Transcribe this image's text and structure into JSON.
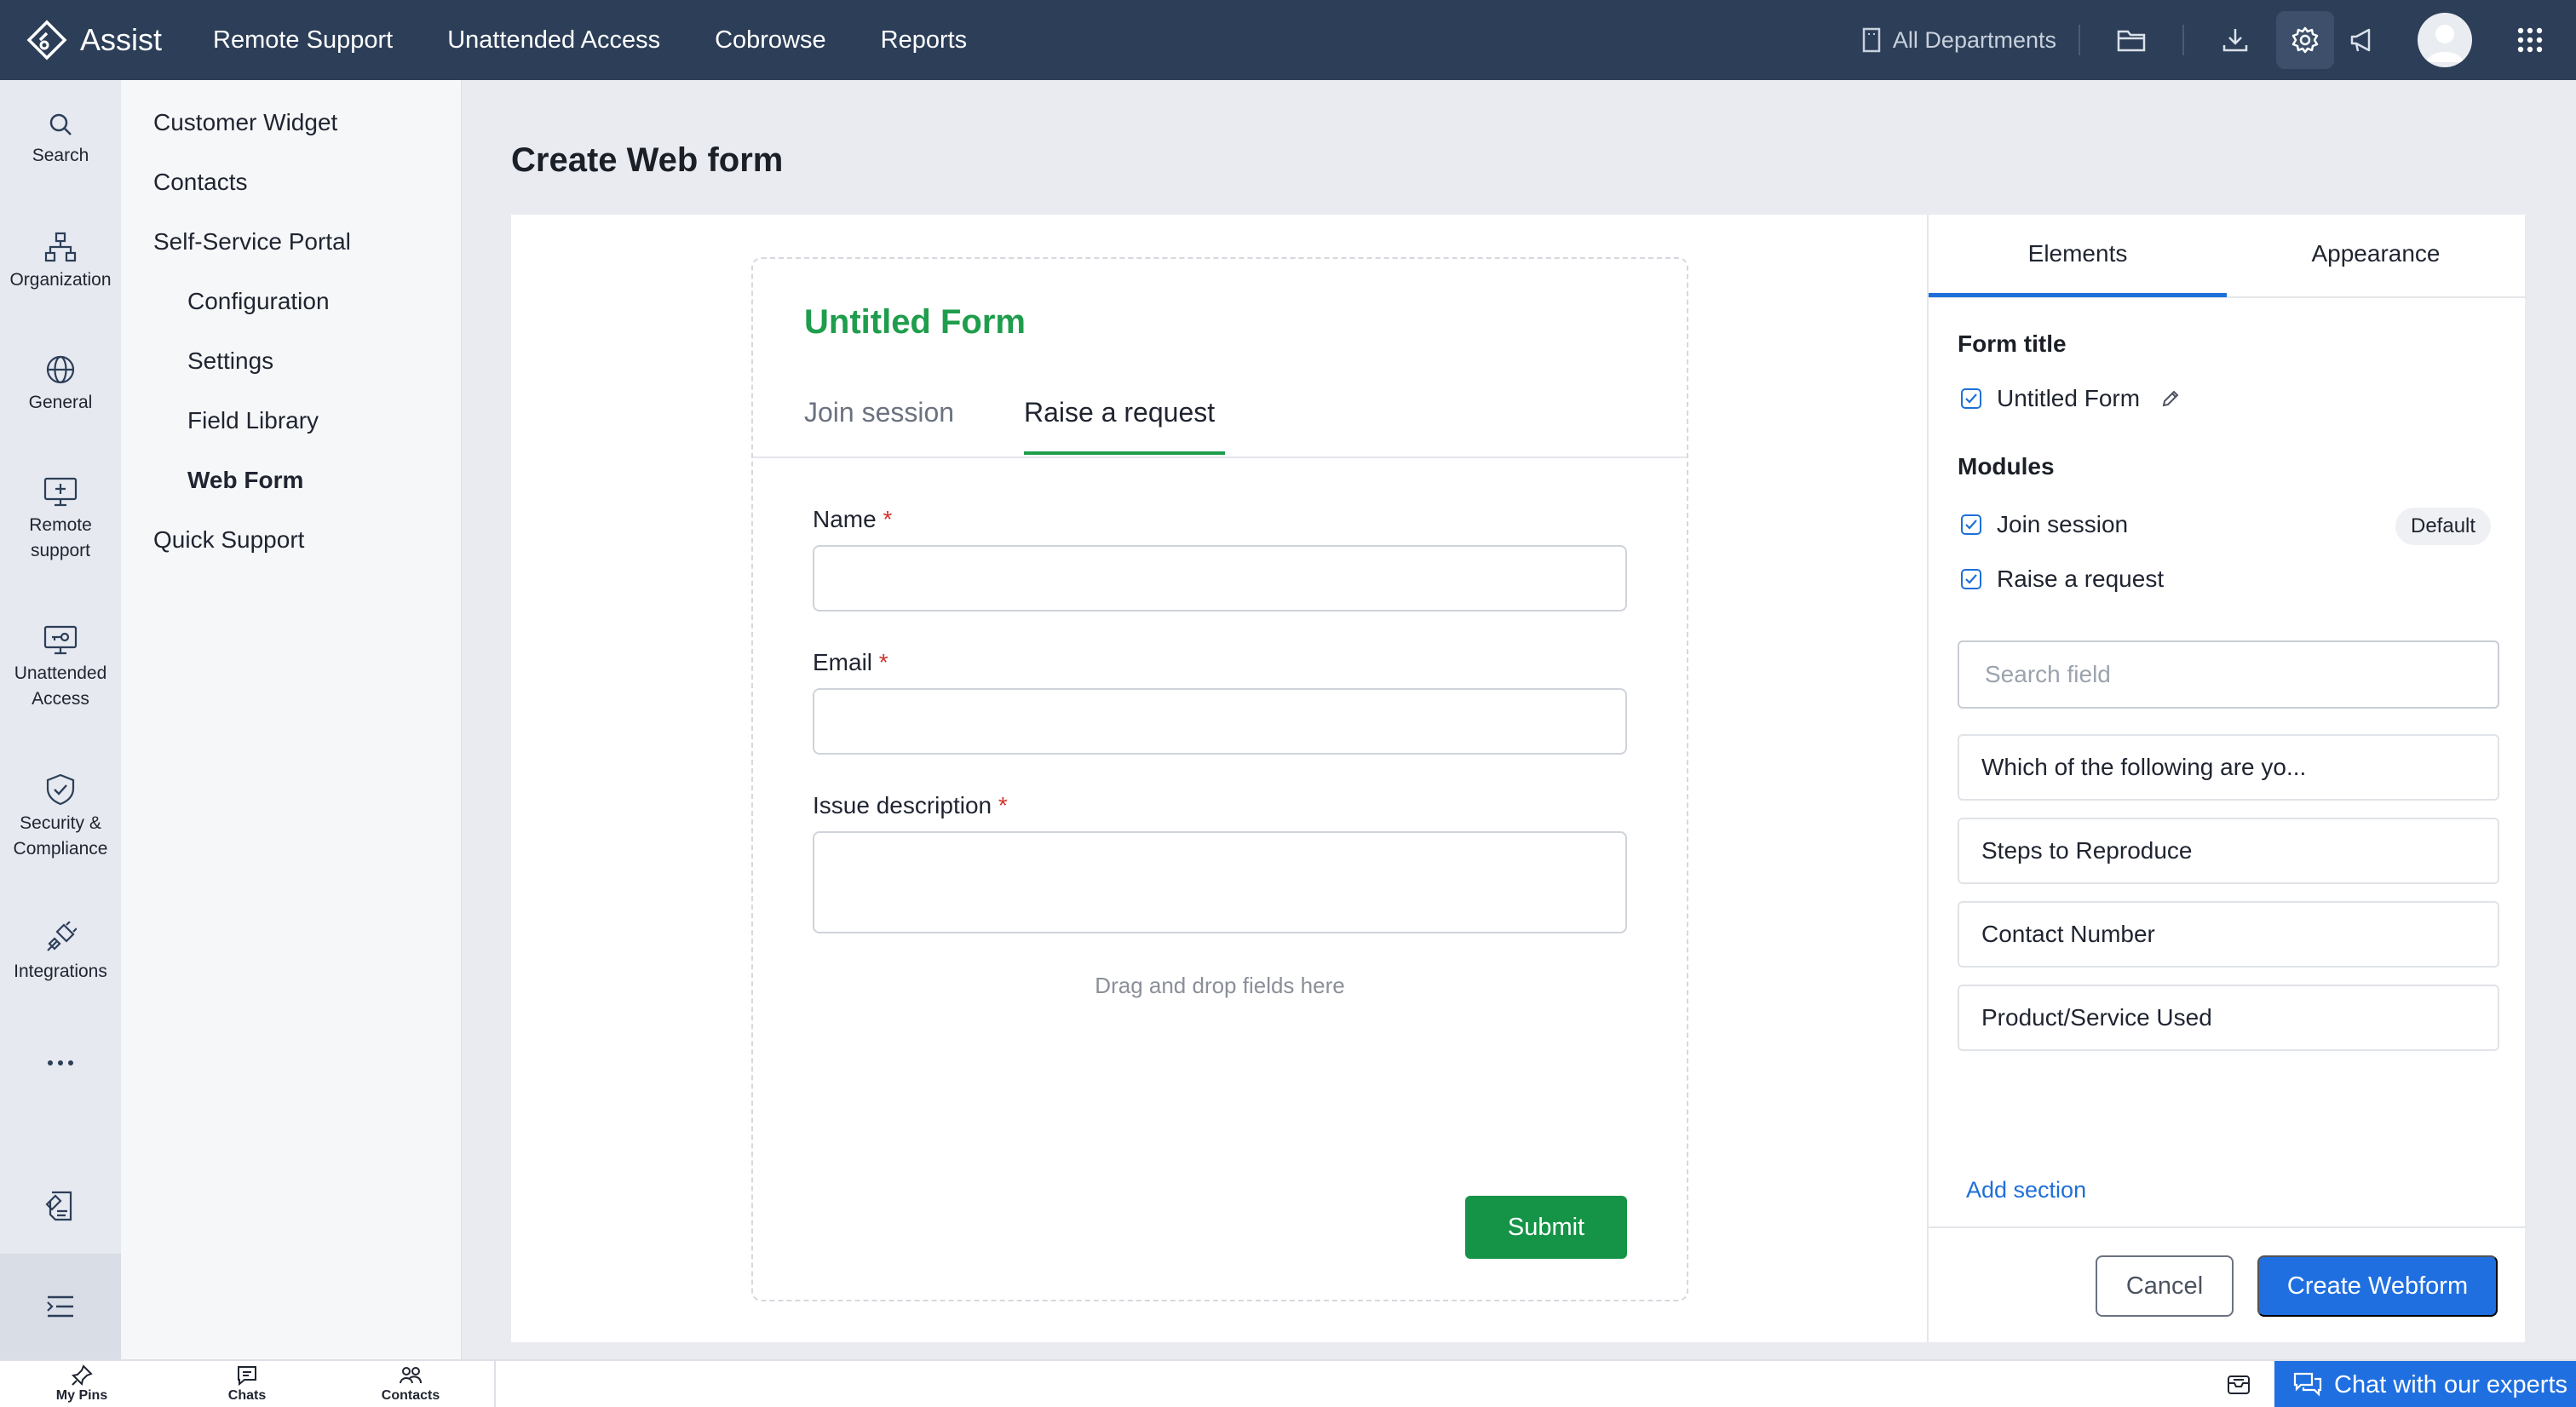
{
  "app": {
    "name": "Assist"
  },
  "topnav": {
    "items": [
      "Remote Support",
      "Unattended Access",
      "Cobrowse",
      "Reports"
    ]
  },
  "topright": {
    "department": "All Departments"
  },
  "leftrail": {
    "items": [
      {
        "label": "Search",
        "icon": "search-icon"
      },
      {
        "label": "Organization",
        "icon": "organization-icon"
      },
      {
        "label": "General",
        "icon": "globe-icon"
      },
      {
        "label": "Remote support",
        "icon": "monitor-plus-icon"
      },
      {
        "label": "Unattended Access",
        "icon": "monitor-key-icon"
      },
      {
        "label": "Security & Compliance",
        "icon": "shield-check-icon"
      },
      {
        "label": "Integrations",
        "icon": "plug-icon"
      }
    ]
  },
  "subnav": {
    "customer_widget": "Customer Widget",
    "contacts": "Contacts",
    "self_service": "Self-Service Portal",
    "configuration": "Configuration",
    "settings": "Settings",
    "field_library": "Field Library",
    "web_form": "Web Form",
    "quick_support": "Quick Support"
  },
  "page": {
    "title": "Create Web form"
  },
  "form": {
    "title": "Untitled Form",
    "tabs": [
      "Join session",
      "Raise a request"
    ],
    "active_tab": "Raise a request",
    "fields": [
      {
        "label": "Name",
        "required": "*"
      },
      {
        "label": "Email",
        "required": "*"
      },
      {
        "label": "Issue description",
        "required": "*"
      }
    ],
    "drop_hint": "Drag and drop fields here",
    "submit_label": "Submit"
  },
  "panel": {
    "tabs": [
      "Elements",
      "Appearance"
    ],
    "active_tab": "Elements",
    "form_title_heading": "Form title",
    "form_title_value": "Untitled Form",
    "modules_heading": "Modules",
    "modules": [
      {
        "label": "Join session",
        "checked": true,
        "badge": "Default"
      },
      {
        "label": "Raise a request",
        "checked": true
      }
    ],
    "search_placeholder": "Search field",
    "available_fields": [
      "Which of the following are yo...",
      "Steps to Reproduce",
      "Contact Number",
      "Product/Service Used"
    ],
    "add_section": "Add section",
    "cancel_label": "Cancel",
    "create_label": "Create Webform"
  },
  "bottombar": {
    "pins": "My Pins",
    "chats": "Chats",
    "contacts": "Contacts",
    "chat_experts": "Chat with our experts"
  },
  "colors": {
    "topbar": "#2c3e58",
    "accent_green": "#1f9d4c",
    "accent_blue": "#1e6fd9",
    "submit_green": "#159447"
  }
}
